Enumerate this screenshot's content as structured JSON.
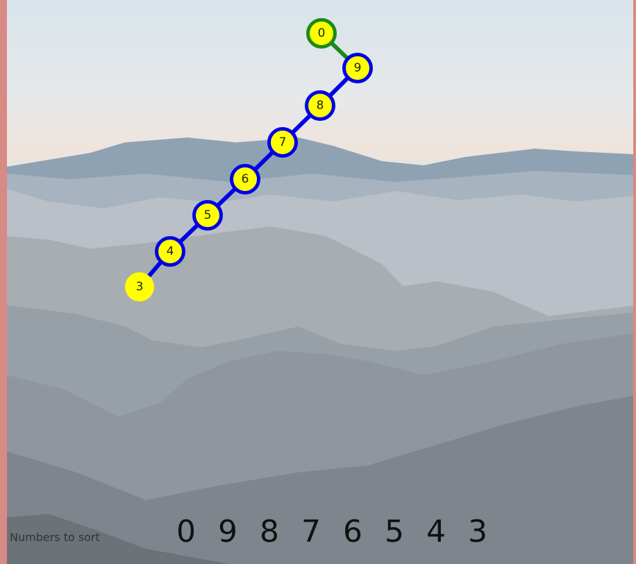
{
  "colors": {
    "node_fill": "#ffff00",
    "ring_blue": "#0000e6",
    "ring_green": "#1a8a1a",
    "edge_blue": "#0000e6",
    "edge_green": "#1a8a1a"
  },
  "graph": {
    "nodes": [
      {
        "label": "0",
        "ring": "green"
      },
      {
        "label": "9",
        "ring": "blue"
      },
      {
        "label": "8",
        "ring": "blue"
      },
      {
        "label": "7",
        "ring": "blue"
      },
      {
        "label": "6",
        "ring": "blue"
      },
      {
        "label": "5",
        "ring": "blue"
      },
      {
        "label": "4",
        "ring": "blue"
      },
      {
        "label": "3",
        "ring": "none"
      }
    ]
  },
  "footer": {
    "caption": "Numbers to sort",
    "numbers": [
      "0",
      "9",
      "8",
      "7",
      "6",
      "5",
      "4",
      "3"
    ]
  }
}
